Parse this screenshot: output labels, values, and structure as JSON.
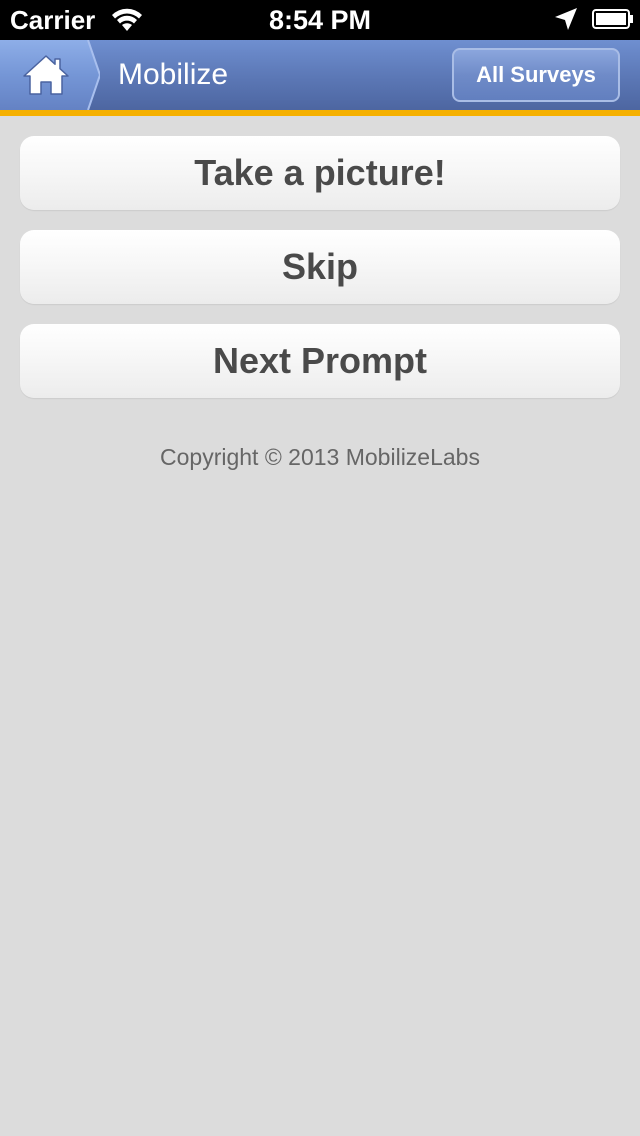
{
  "status_bar": {
    "carrier": "Carrier",
    "time": "8:54 PM",
    "icons": [
      "wifi-icon",
      "location-arrow-icon",
      "battery-icon"
    ]
  },
  "nav_bar": {
    "home_icon": "home-icon",
    "title": "Mobilize",
    "right_button_label": "All Surveys",
    "accent_color": "#f5b000",
    "bar_color": "#5b77b5"
  },
  "actions": {
    "take_picture_label": "Take a picture!",
    "skip_label": "Skip",
    "next_prompt_label": "Next Prompt"
  },
  "footer": {
    "copyright": "Copyright © 2013 MobilizeLabs"
  }
}
